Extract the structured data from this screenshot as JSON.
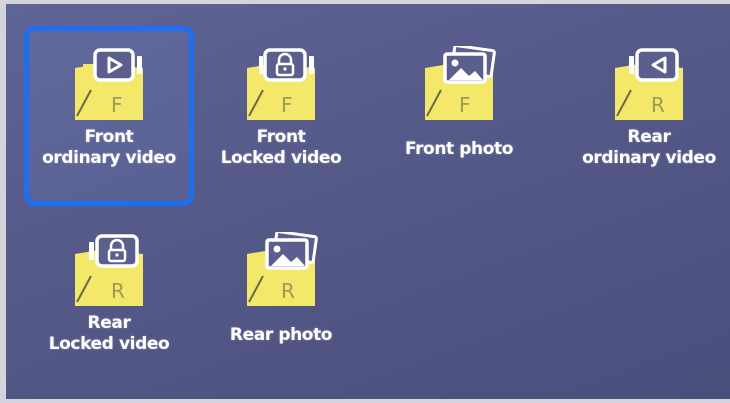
{
  "folders": [
    {
      "id": "front-ordinary-video",
      "line1": "Front",
      "line2": "ordinary video",
      "letter": "F",
      "icon": "video-icon",
      "selected": true
    },
    {
      "id": "front-locked-video",
      "line1": "Front",
      "line2": "Locked video",
      "letter": "F",
      "icon": "lock-icon",
      "selected": false
    },
    {
      "id": "front-photo",
      "line1": "Front photo",
      "line2": "",
      "letter": "F",
      "icon": "photo-icon",
      "selected": false
    },
    {
      "id": "rear-ordinary-video",
      "line1": "Rear",
      "line2": "ordinary video",
      "letter": "R",
      "icon": "video-icon",
      "selected": false
    },
    {
      "id": "rear-locked-video",
      "line1": "Rear",
      "line2": "Locked video",
      "letter": "R",
      "icon": "lock-icon",
      "selected": false
    },
    {
      "id": "rear-photo",
      "line1": "Rear photo",
      "line2": "",
      "letter": "R",
      "icon": "photo-icon",
      "selected": false
    }
  ],
  "colors": {
    "background": "#555a89",
    "folder": "#f3e86a",
    "selection": "#1c6ff0",
    "text": "#ffffff"
  }
}
